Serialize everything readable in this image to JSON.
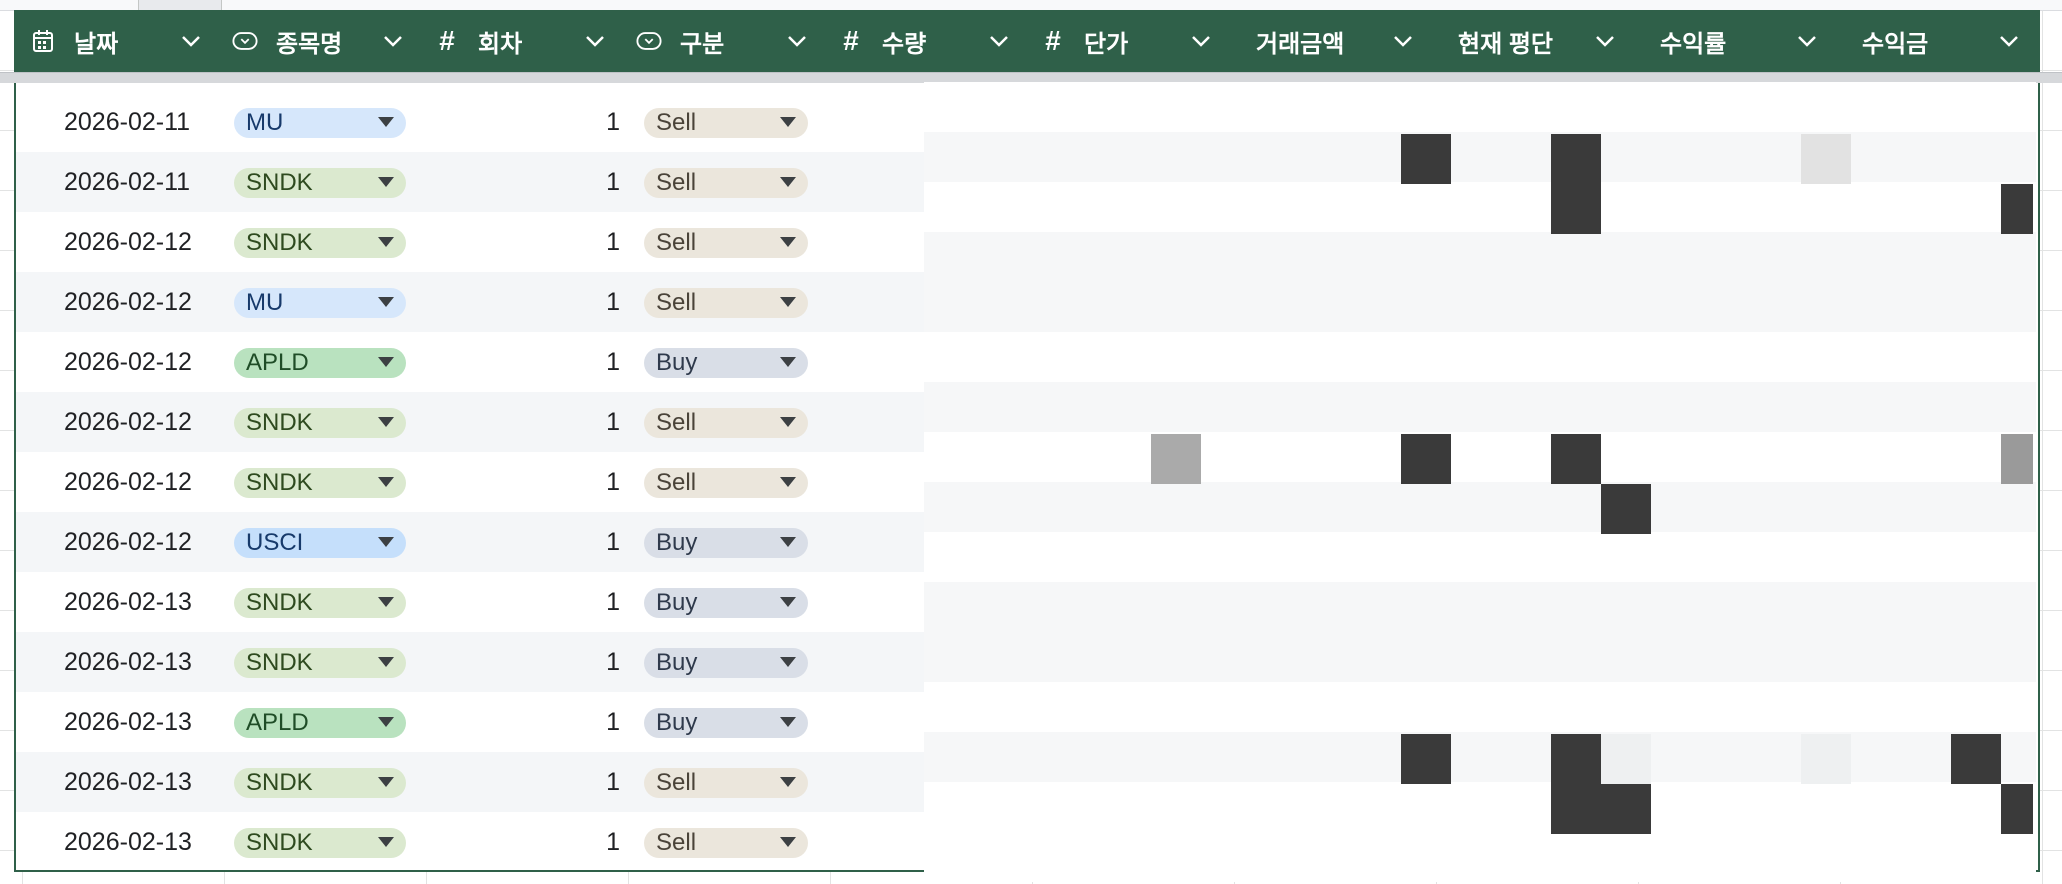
{
  "header": {
    "columns": [
      {
        "label": "날짜",
        "icon": "calendar-icon"
      },
      {
        "label": "종목명",
        "icon": "dropdown-chip-icon"
      },
      {
        "label": "회차",
        "icon": "hash-icon"
      },
      {
        "label": "구분",
        "icon": "dropdown-chip-icon"
      },
      {
        "label": "수량",
        "icon": "hash-icon"
      },
      {
        "label": "단가",
        "icon": "hash-icon"
      },
      {
        "label": "거래금액",
        "icon": ""
      },
      {
        "label": "현재 평단",
        "icon": ""
      },
      {
        "label": "수익률",
        "icon": ""
      },
      {
        "label": "수익금",
        "icon": ""
      }
    ],
    "hash_glyph": "#"
  },
  "colors": {
    "header_bg": "#2f6049",
    "chip_mu": "#d6e7fb",
    "chip_sndk": "#dbe9cf",
    "chip_apld": "#b9e2bf",
    "chip_usci": "#c5dffb",
    "chip_sell": "#ebe6dc",
    "chip_buy": "#d9dee7"
  },
  "rows": [
    {
      "date": "2026-02-11",
      "ticker": "MU",
      "round": "1",
      "kind": "Sell"
    },
    {
      "date": "2026-02-11",
      "ticker": "SNDK",
      "round": "1",
      "kind": "Sell"
    },
    {
      "date": "2026-02-12",
      "ticker": "SNDK",
      "round": "1",
      "kind": "Sell"
    },
    {
      "date": "2026-02-12",
      "ticker": "MU",
      "round": "1",
      "kind": "Sell"
    },
    {
      "date": "2026-02-12",
      "ticker": "APLD",
      "round": "1",
      "kind": "Buy"
    },
    {
      "date": "2026-02-12",
      "ticker": "SNDK",
      "round": "1",
      "kind": "Sell"
    },
    {
      "date": "2026-02-12",
      "ticker": "SNDK",
      "round": "1",
      "kind": "Sell"
    },
    {
      "date": "2026-02-12",
      "ticker": "USCI",
      "round": "1",
      "kind": "Buy"
    },
    {
      "date": "2026-02-13",
      "ticker": "SNDK",
      "round": "1",
      "kind": "Buy"
    },
    {
      "date": "2026-02-13",
      "ticker": "SNDK",
      "round": "1",
      "kind": "Buy"
    },
    {
      "date": "2026-02-13",
      "ticker": "APLD",
      "round": "1",
      "kind": "Buy"
    },
    {
      "date": "2026-02-13",
      "ticker": "SNDK",
      "round": "1",
      "kind": "Sell"
    },
    {
      "date": "2026-02-13",
      "ticker": "SNDK",
      "round": "1",
      "kind": "Sell"
    }
  ]
}
